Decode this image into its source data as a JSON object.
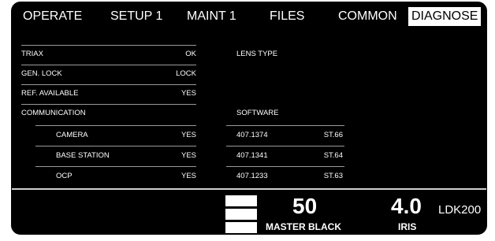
{
  "tabs": {
    "operate": "OPERATE",
    "setup1": "SETUP 1",
    "maint1": "MAINT 1",
    "files": "FILES",
    "common": "COMMON",
    "diagnose": "DIAGNOSE"
  },
  "status": {
    "triax": {
      "label": "TRIAX",
      "value": "OK"
    },
    "genlock": {
      "label": "GEN. LOCK",
      "value": "LOCK"
    },
    "ref": {
      "label": "REF. AVAILABLE",
      "value": "YES"
    },
    "communication": "COMMUNICATION",
    "camera": {
      "label": "CAMERA",
      "value": "YES"
    },
    "base_station": {
      "label": "BASE STATION",
      "value": "YES"
    },
    "ocp": {
      "label": "OCP",
      "value": "YES"
    }
  },
  "lens": {
    "label": "LENS TYPE"
  },
  "software": {
    "label": "SOFTWARE",
    "camera": {
      "version": "407.1374",
      "station": "ST.66"
    },
    "base_station": {
      "version": "407.1341",
      "station": "ST.64"
    },
    "ocp": {
      "version": "407.1233",
      "station": "ST.63"
    }
  },
  "bottom": {
    "master_black_value": "50",
    "master_black_label": "MASTER BLACK",
    "iris_value": "4.0",
    "iris_label": "IRIS",
    "model": "LDK200"
  },
  "colors": {
    "background": "#000000",
    "text": "#ffffff",
    "active_tab_bg": "#ffffff",
    "active_tab_text": "#000000"
  }
}
